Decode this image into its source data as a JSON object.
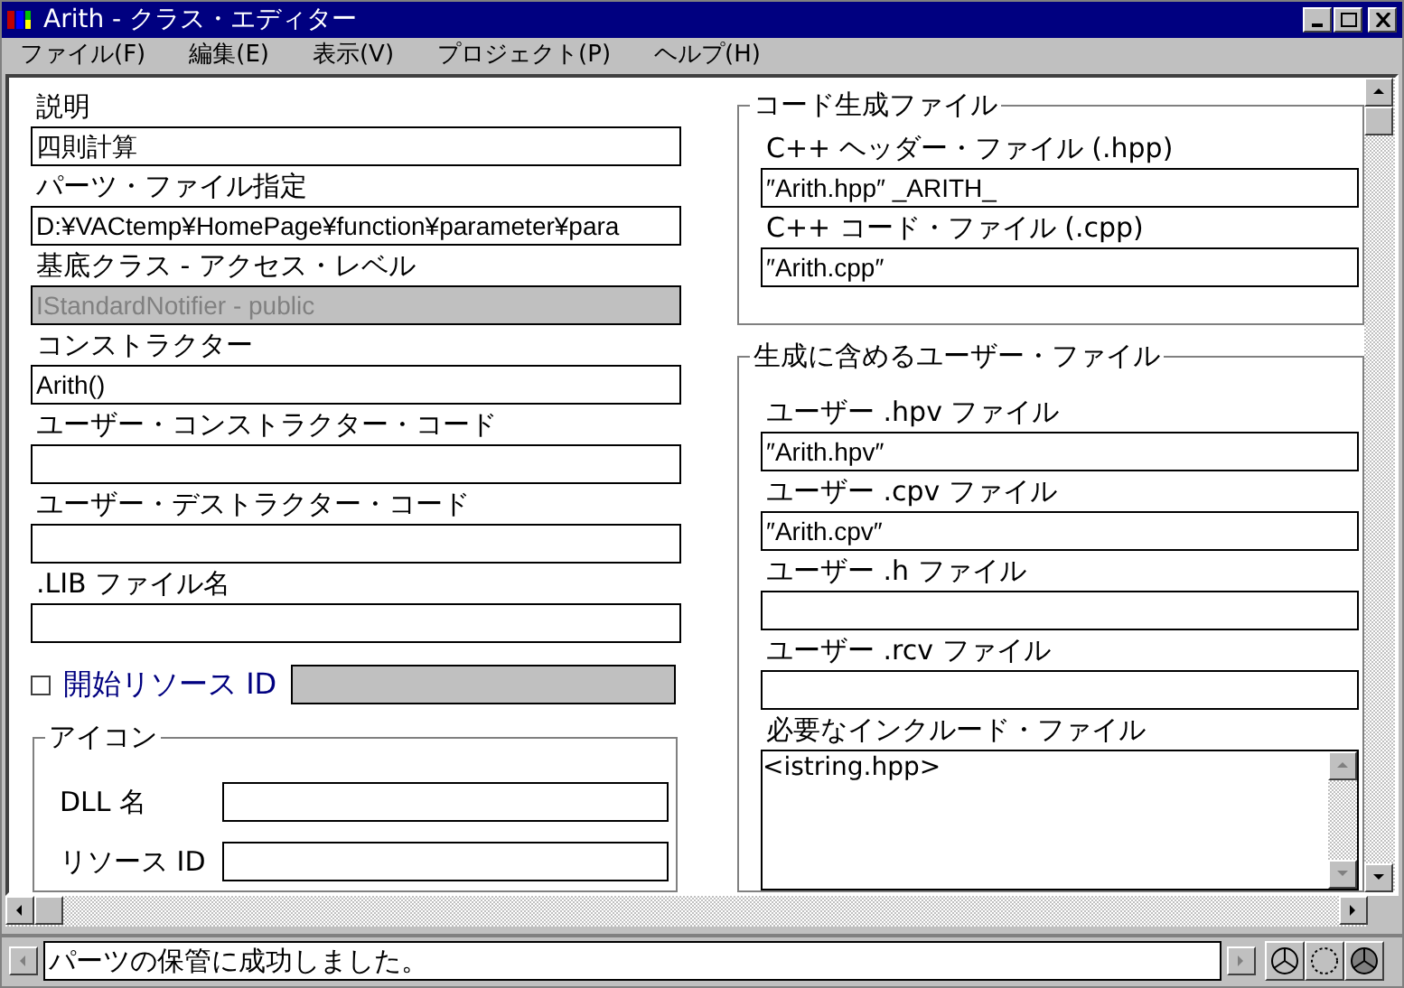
{
  "window": {
    "title": "Arith - クラス・エディター"
  },
  "menu": [
    "ファイル(F)",
    "編集(E)",
    "表示(V)",
    "プロジェクト(P)",
    "ヘルプ(H)"
  ],
  "left_fields": [
    {
      "label": "説明",
      "value": "四則計算",
      "disabled": false
    },
    {
      "label": "パーツ・ファイル指定",
      "value": "D:¥VACtemp¥HomePage¥function¥parameter¥para",
      "disabled": false
    },
    {
      "label": "基底クラス - アクセス・レベル",
      "value": "IStandardNotifier - public",
      "disabled": true
    },
    {
      "label": "コンストラクター",
      "value": "Arith()",
      "disabled": false
    },
    {
      "label": "ユーザー・コンストラクター・コード",
      "disabled": false
    },
    {
      "label": "ユーザー・デストラクター・コード",
      "disabled": false
    },
    {
      "label": ".LIB ファイル名",
      "disabled": false
    }
  ],
  "start_resource": {
    "label": "開始リソース ID",
    "checked": false,
    "disabled": true
  },
  "icon_group": {
    "title": "アイコン",
    "fields": [
      {
        "label": "DLL 名"
      },
      {
        "label": "リソース ID"
      }
    ]
  },
  "code_files": {
    "title": "コード生成ファイル",
    "fields": [
      {
        "label": "C++ ヘッダー・ファイル (.hpp)",
        "value": "″Arith.hpp″  _ARITH_"
      },
      {
        "label": "C++ コード・ファイル (.cpp)",
        "value": "″Arith.cpp″"
      }
    ]
  },
  "user_files": {
    "title": "生成に含めるユーザー・ファイル",
    "fields": [
      {
        "label": "ユーザー .hpv ファイル",
        "value": "″Arith.hpv″"
      },
      {
        "label": "ユーザー .cpv ファイル",
        "value": "″Arith.cpv″"
      },
      {
        "label": "ユーザー .h ファイル"
      },
      {
        "label": "ユーザー .rcv ファイル"
      }
    ],
    "includes": {
      "label": "必要なインクルード・ファイル",
      "value": "<istring.hpp>"
    }
  },
  "status_bar": {
    "message": "パーツの保管に成功しました。"
  }
}
